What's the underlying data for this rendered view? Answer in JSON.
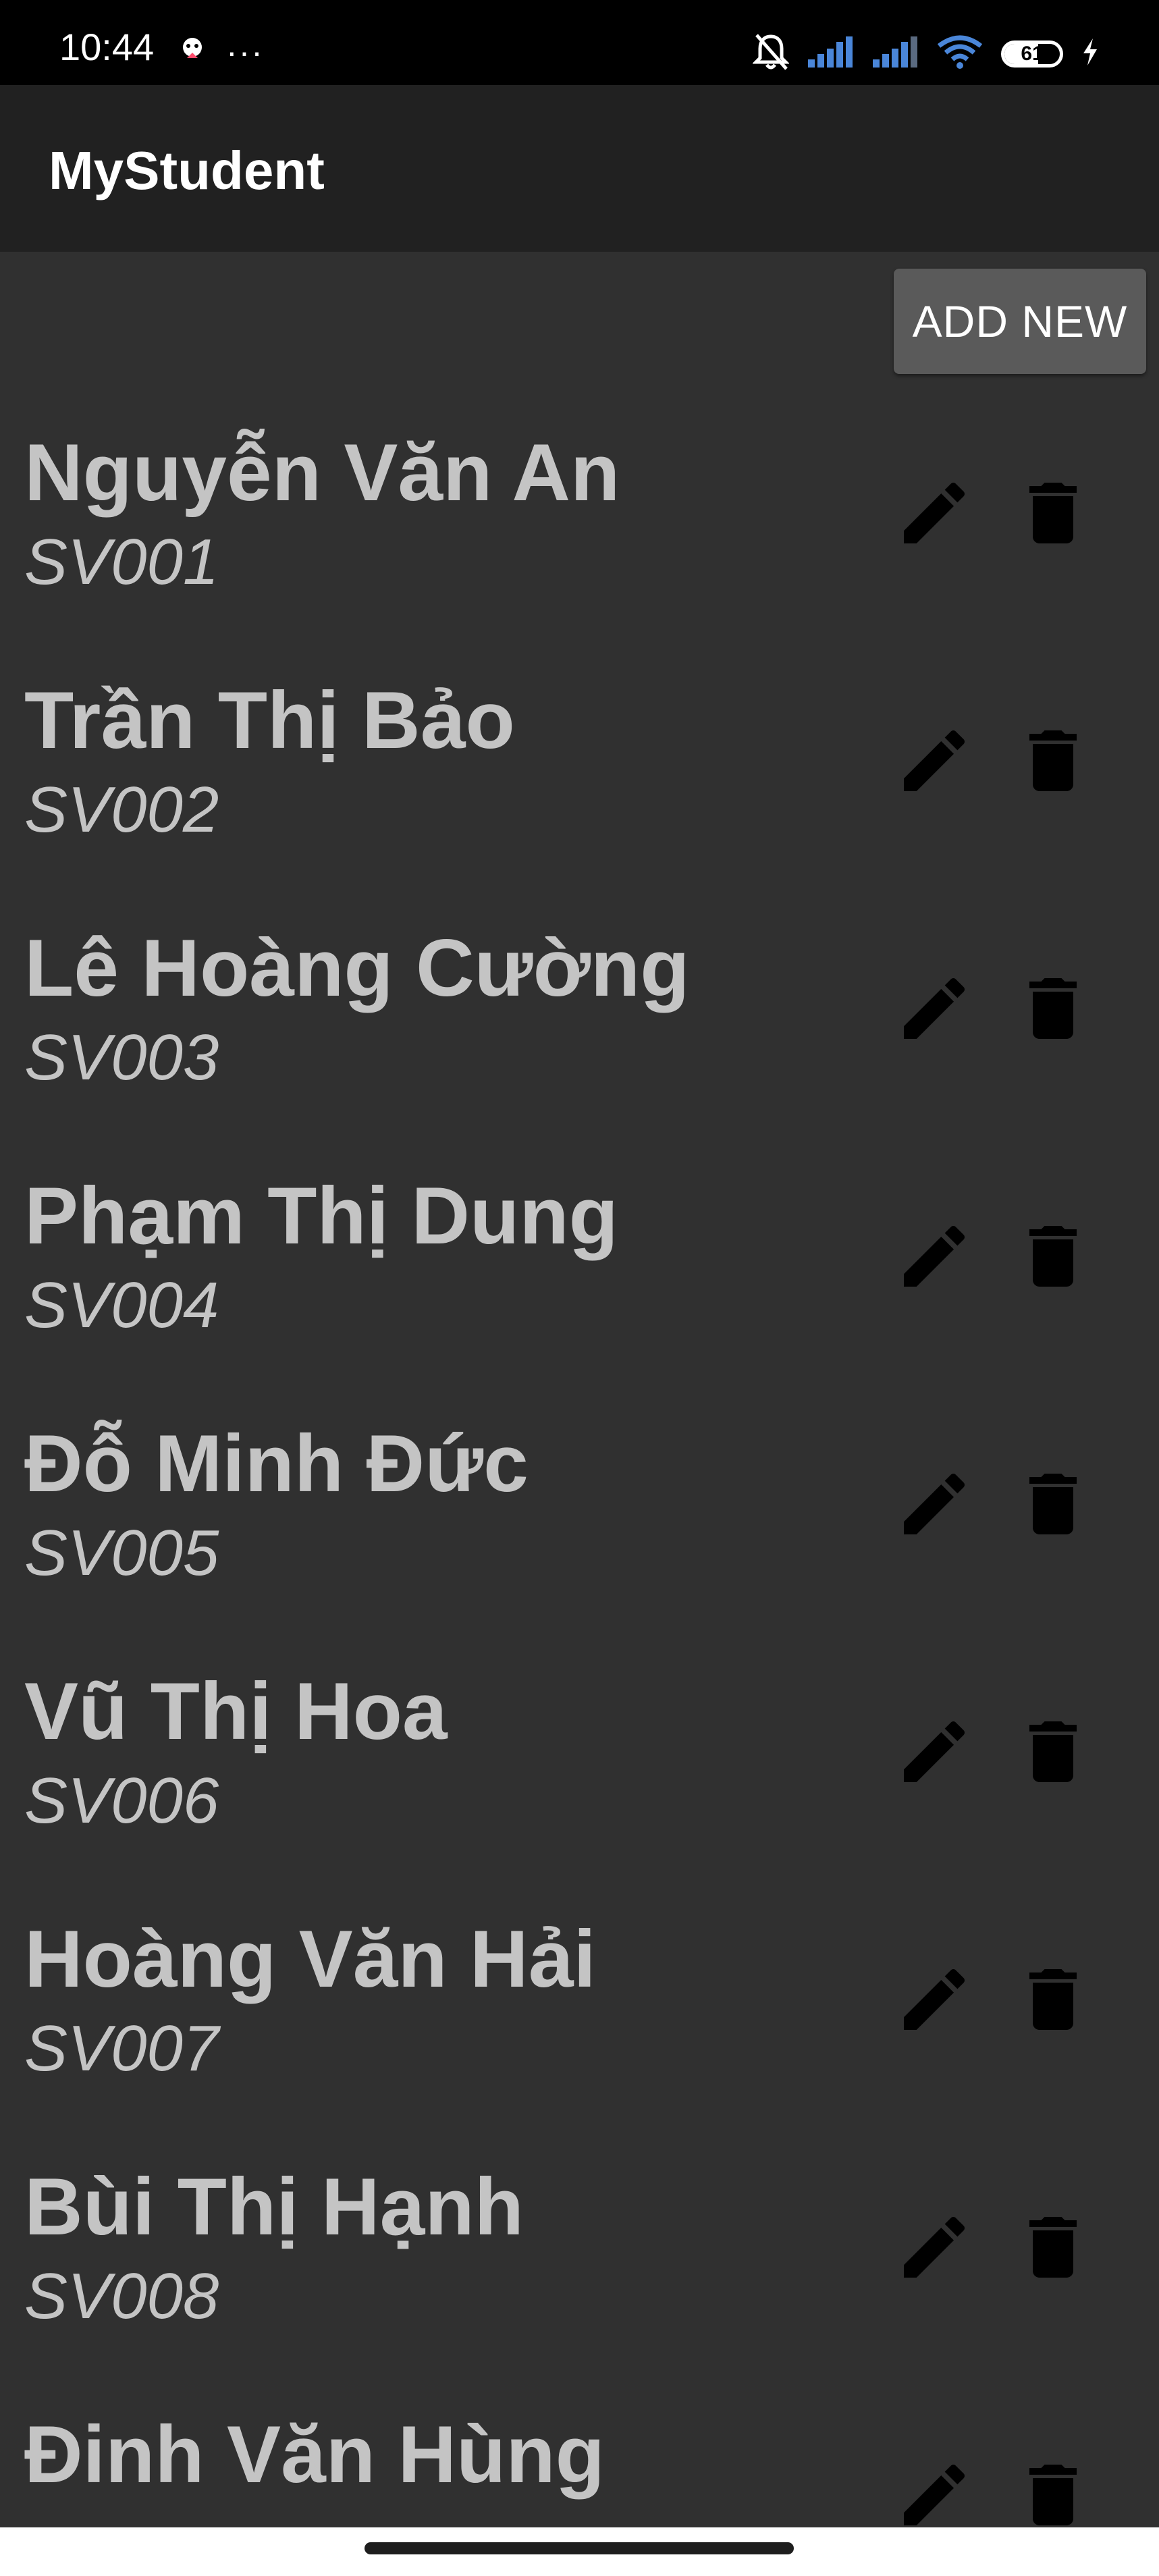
{
  "status_bar": {
    "time": "10:44",
    "more_indicator": "···",
    "battery_level": "61",
    "icons": [
      "assistant-icon",
      "bell-off-icon",
      "signal-icon",
      "signal-icon",
      "wifi-icon",
      "battery-icon",
      "charging-icon"
    ]
  },
  "app_bar": {
    "title": "MyStudent"
  },
  "toolbar": {
    "add_new_label": "ADD NEW"
  },
  "students": [
    {
      "name": "Nguyễn Văn An",
      "code": "SV001"
    },
    {
      "name": "Trần Thị Bảo",
      "code": "SV002"
    },
    {
      "name": "Lê Hoàng Cường",
      "code": "SV003"
    },
    {
      "name": "Phạm Thị Dung",
      "code": "SV004"
    },
    {
      "name": "Đỗ Minh Đức",
      "code": "SV005"
    },
    {
      "name": "Vũ Thị Hoa",
      "code": "SV006"
    },
    {
      "name": "Hoàng Văn Hải",
      "code": "SV007"
    },
    {
      "name": "Bùi Thị Hạnh",
      "code": "SV008"
    },
    {
      "name": "Đinh Văn Hùng",
      "code": ""
    }
  ],
  "colors": {
    "status_bar_bg": "#000000",
    "app_bar_bg": "#212121",
    "list_bg": "#303030",
    "button_bg": "#5a5a5a",
    "text_primary": "#c4c4c4",
    "icon_color": "#000000",
    "signal_accent": "#4a86d9"
  }
}
